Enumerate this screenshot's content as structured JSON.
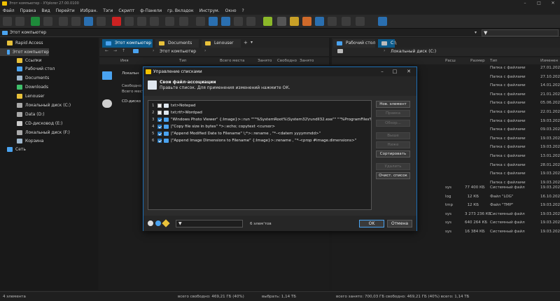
{
  "window": {
    "title": "Этот компьютер - XYplorer 27.00.0100"
  },
  "menu": [
    "Файл",
    "Правка",
    "Вид",
    "Перейти",
    "Избран.",
    "Тэги",
    "Скрипт",
    "ф-Панели",
    "гр. Вкладок",
    "Инструм.",
    "Окно",
    "?"
  ],
  "address": {
    "path": "Этот компьютер"
  },
  "tree": [
    {
      "label": "Rapid Access",
      "icon": "star-icon",
      "color": "#e8c13a"
    },
    {
      "label": "Этот компьютер",
      "icon": "computer-icon",
      "color": "#4aa3f0"
    },
    {
      "label": "Ссылки",
      "icon": "folder-icon",
      "color": "#e8c13a"
    },
    {
      "label": "Рабочий стол",
      "icon": "desktop-icon",
      "color": "#4aa3f0"
    },
    {
      "label": "Documents",
      "icon": "documents-icon",
      "color": "#9fb7cc"
    },
    {
      "label": "Downloads",
      "icon": "downloads-icon",
      "color": "#3fbf6a"
    },
    {
      "label": "Lenouser",
      "icon": "folder-icon",
      "color": "#e8c13a"
    },
    {
      "label": "Локальный диск (C:)",
      "icon": "drive-icon",
      "color": "#aaaaaa"
    },
    {
      "label": "Data (D:)",
      "icon": "drive-icon",
      "color": "#aaaaaa"
    },
    {
      "label": "CD-дисковод (E:)",
      "icon": "cd-icon",
      "color": "#cccccc"
    },
    {
      "label": "Локальный диск (F:)",
      "icon": "drive-icon",
      "color": "#aaaaaa"
    },
    {
      "label": "Корзина",
      "icon": "recycle-bin-icon",
      "color": "#9fb7cc"
    },
    {
      "label": "Сеть",
      "icon": "network-icon",
      "color": "#4aa3f0"
    }
  ],
  "left_pane": {
    "tabs": [
      "Этот компьютер",
      "Documents",
      "Lenouser"
    ],
    "crumb": "Этот компьютер",
    "columns": [
      "Имя",
      "Тип",
      "Всего места",
      "Занято",
      "Свободно",
      "Занято"
    ],
    "rows": [
      {
        "name": "Локальн",
        "sub1": "Свободно",
        "sub2": "Всего места"
      },
      {
        "name": "CD-диско",
        "sub1": "",
        "sub2": ""
      }
    ]
  },
  "right_pane": {
    "tabs": [
      "Рабочий стол",
      "C:\\"
    ],
    "crumb": "Локальный диск (C:)",
    "columns": [
      "Расш",
      "Размер",
      "Тип",
      "Изменен"
    ],
    "folder_type": "Папка с файлами",
    "dates": [
      "27.01.2023",
      "27.10.2023",
      "14.01.2023",
      "21.01.2023",
      "05.06.2021",
      "22.01.2023",
      "19.03.2023",
      "09.03.2023",
      "19.03.2023",
      "19.03.2023",
      "13.01.2023",
      "28.01.2023",
      "19.03.2023",
      "19.03.2023"
    ],
    "files": [
      {
        "ext": "sys",
        "size": "77 400 КБ",
        "type": "Системный файл",
        "date": "19.03.2023"
      },
      {
        "ext": "log",
        "size": "12 КБ",
        "type": "Файл \"LOG\"",
        "date": "16.10.2024"
      },
      {
        "ext": "tmp",
        "size": "12 КБ",
        "type": "Файл \"TMP\"",
        "date": "19.03.2023"
      },
      {
        "ext": "sys",
        "size": "3 273 236 КБ",
        "type": "Системный файл",
        "date": "19.03.2023"
      },
      {
        "ext": "sys",
        "size": "640 264 КБ",
        "type": "Системный файл",
        "date": "19.03.2023"
      },
      {
        "ext": "sys",
        "size": "16 384 КБ",
        "type": "Системный файл",
        "date": "19.03.2023"
      }
    ]
  },
  "status": {
    "count": "4 элемента",
    "left": "всего свободно: 469,21 ГБ (40%)",
    "mid": "выбрать: 1,14 ТБ",
    "right": "всего  занято: 700,03 ГБ  свободно: 469,21 ГБ (40%)  всего: 1,14 ТБ"
  },
  "dialog": {
    "title": "Управление списками",
    "heading": "Свои файл-ассоциации",
    "subheading": "Правьте список. Для применения изменений нажмите ОК.",
    "items": [
      {
        "num": "1",
        "checked": false,
        "text": "txt>Notepad",
        "icon": "notepad-icon",
        "color": "#dfe7ef"
      },
      {
        "num": "2",
        "checked": false,
        "text": "txt;rtf>Wordpad",
        "icon": "wordpad-icon",
        "color": "#dfe7ef"
      },
      {
        "num": "3",
        "checked": true,
        "text": "\"Windows Photo Viewer\" {:Image}>::run \"\"\"%SystemRoot%\\System32\\rundll32.exe\"\" \"\"%ProgramFiles%\\Windo",
        "icon": "photo-viewer-icon",
        "color": "#4aa3f0"
      },
      {
        "num": "4",
        "checked": true,
        "text": "|\"Copy file size in bytes\" *>::echo; copytext <cursor>",
        "icon": "script-icon",
        "color": "#4aa3f0"
      },
      {
        "num": "5",
        "checked": true,
        "text": "|\"Append Modified Date to Filename\" \\;*>::rename , \"*-<datem yyyymmdd>\"",
        "icon": "script-icon",
        "color": "#4aa3f0"
      },
      {
        "num": "6",
        "checked": true,
        "text": "|\"Append Image Dimensions to Filename\" {:Image}>::rename , \"*-<prop #image.dimensions>\"",
        "icon": "script-icon",
        "color": "#4aa3f0"
      }
    ],
    "buttons": [
      {
        "label": "Нов. элемент",
        "enabled": true
      },
      {
        "label": "Правка",
        "enabled": false
      },
      {
        "label": "Обзор...",
        "enabled": false
      },
      {
        "label": "Выше",
        "enabled": false
      },
      {
        "label": "Ниже",
        "enabled": false
      },
      {
        "label": "Сортировать",
        "enabled": true
      },
      {
        "label": "Удалить",
        "enabled": false
      },
      {
        "label": "Очист. список",
        "enabled": true
      }
    ],
    "count": "6 элем'тов",
    "ok": "OK",
    "cancel": "Отмена"
  },
  "colors": {
    "accent": "#1e6fb5",
    "active_tab": "#0c5a8a",
    "folder": "#e8c13a"
  }
}
